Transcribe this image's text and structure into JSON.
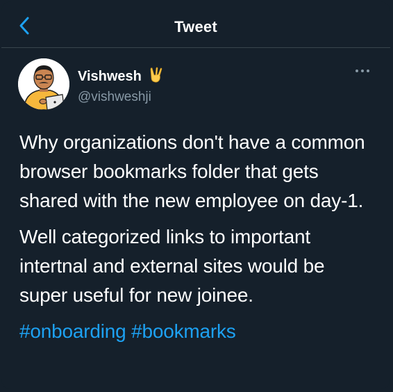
{
  "header": {
    "title": "Tweet",
    "back_icon": "chevron-left-icon"
  },
  "author": {
    "display_name": "Vishwesh",
    "emoji_icon": "victory-hand-icon",
    "handle": "@vishweshji"
  },
  "tweet": {
    "paragraphs": [
      "Why organizations don't have a common browser bookmarks folder that gets shared with the new employee on day-1.",
      "Well categorized links to important intertnal and external sites would be super useful for new joinee."
    ],
    "hashtags": [
      "#onboarding",
      "#bookmarks"
    ]
  },
  "colors": {
    "background": "#15202b",
    "accent": "#1da1f2",
    "secondary_text": "#8899a6",
    "divider": "#38444d"
  }
}
